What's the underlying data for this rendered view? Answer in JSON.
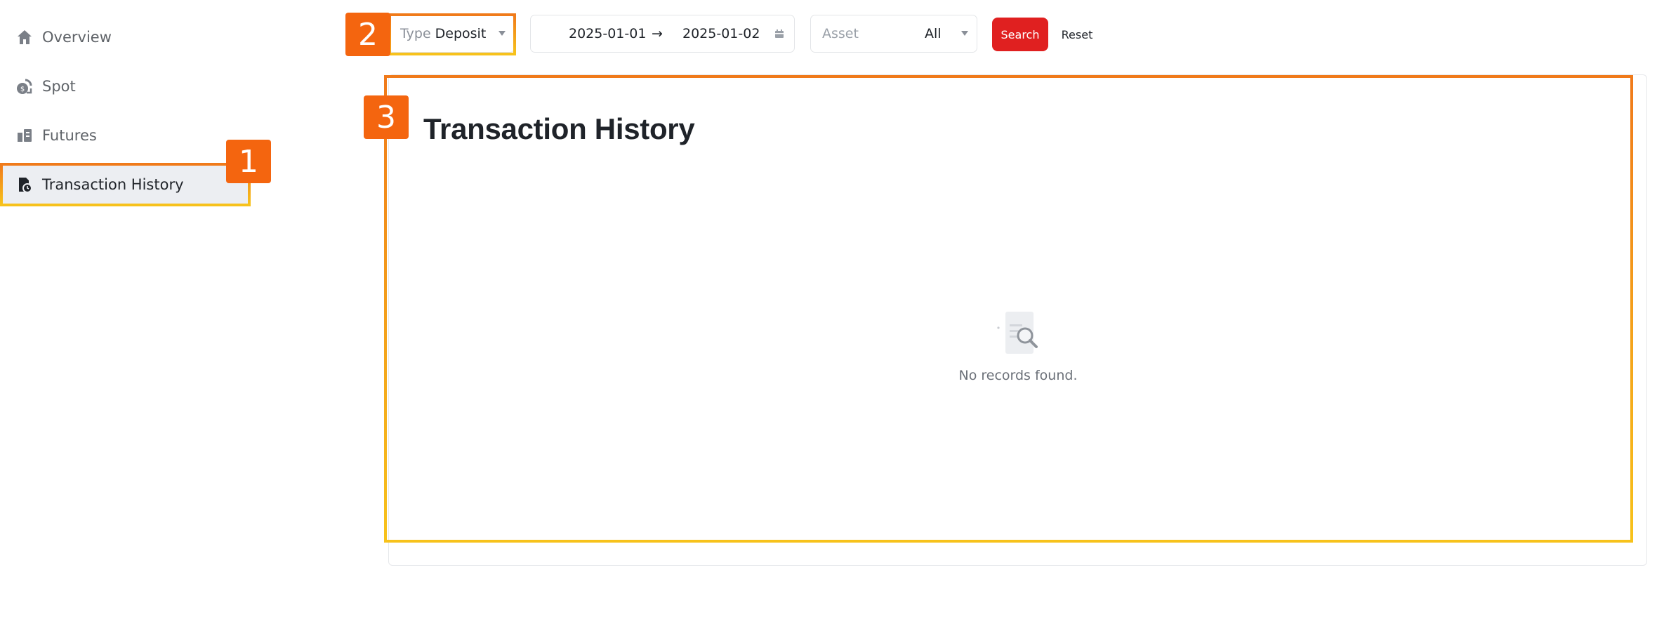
{
  "sidebar": {
    "items": [
      {
        "label": "Overview",
        "icon": "home-icon",
        "active": false
      },
      {
        "label": "Spot",
        "icon": "spot-coins-icon",
        "active": false
      },
      {
        "label": "Futures",
        "icon": "futures-icon",
        "active": false
      },
      {
        "label": "Transaction History",
        "icon": "history-document-icon",
        "active": true
      }
    ]
  },
  "filters": {
    "type": {
      "prefix": "Type",
      "value": "Deposit"
    },
    "date_range": {
      "start": "2025-01-01",
      "arrow": "→",
      "end": "2025-01-02"
    },
    "asset": {
      "placeholder": "Asset",
      "value": "All"
    },
    "search_label": "Search",
    "reset_label": "Reset"
  },
  "main": {
    "title": "Transaction History",
    "empty_text": "No records found."
  },
  "annotations": [
    {
      "number": "1"
    },
    {
      "number": "2"
    },
    {
      "number": "3"
    }
  ],
  "colors": {
    "accent": "#e02020",
    "highlight_orange": "#f07a1a",
    "highlight_yellow": "#f7c21b",
    "badge": "#f4650f",
    "active_nav_bg": "#eceef2"
  }
}
